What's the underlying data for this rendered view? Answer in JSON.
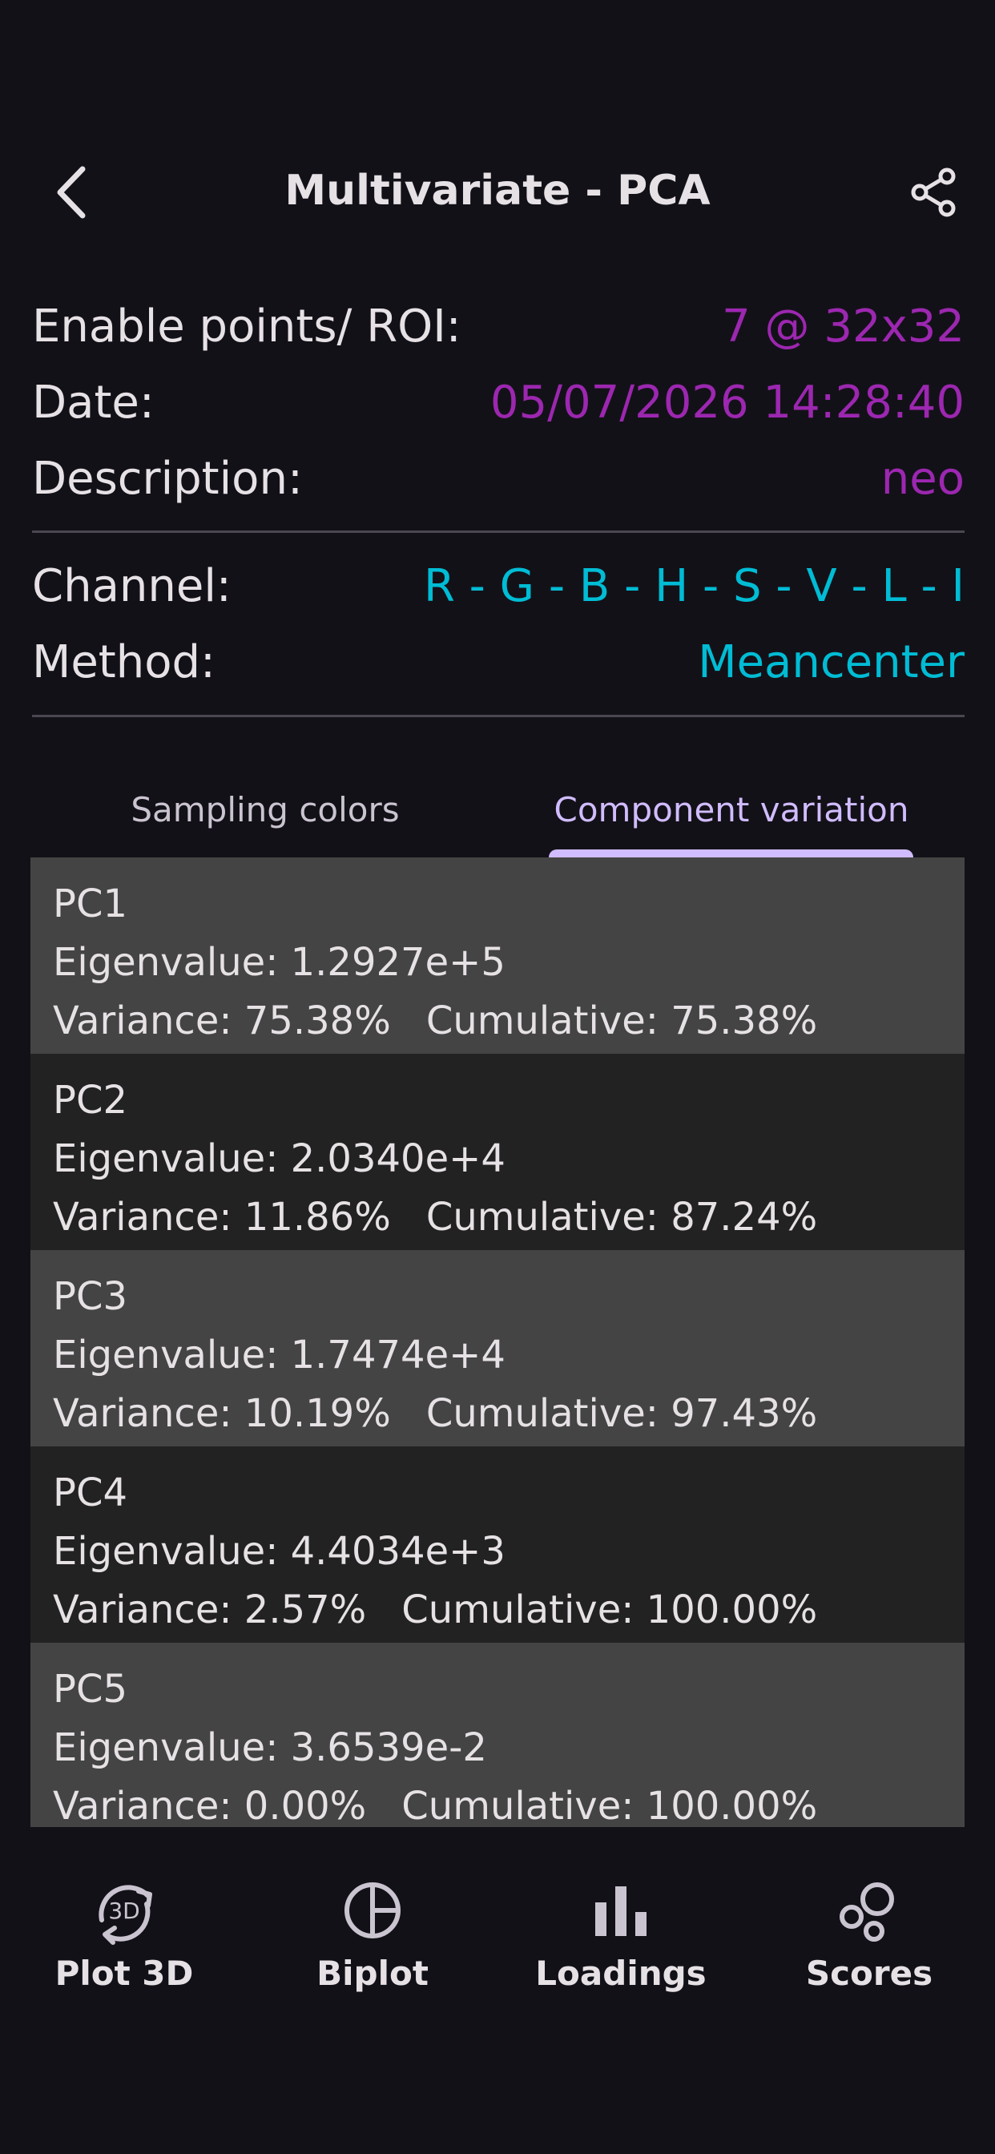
{
  "header": {
    "title": "Multivariate - PCA",
    "back_icon": "chevron-left-icon",
    "share_icon": "share-icon"
  },
  "info": {
    "enable_points_label": "Enable points/ ROI:",
    "enable_points_value": "7 @ 32x32",
    "date_label": "Date:",
    "date_value": "05/07/2026 14:28:40",
    "description_label": "Description:",
    "description_value": "neo",
    "channel_label": "Channel:",
    "channel_value": "R - G - B - H - S - V - L - I",
    "method_label": "Method:",
    "method_value": "Meancenter"
  },
  "tabs": [
    {
      "label": "Sampling colors",
      "active": false
    },
    {
      "label": "Component variation",
      "active": true
    }
  ],
  "components": [
    {
      "name": "PC1",
      "eigenvalue": "Eigenvalue: 1.2927e+5",
      "variance": "Variance: 75.38%",
      "cumulative": "Cumulative: 75.38%"
    },
    {
      "name": "PC2",
      "eigenvalue": "Eigenvalue: 2.0340e+4",
      "variance": "Variance: 11.86%",
      "cumulative": "Cumulative: 87.24%"
    },
    {
      "name": "PC3",
      "eigenvalue": "Eigenvalue: 1.7474e+4",
      "variance": "Variance: 10.19%",
      "cumulative": "Cumulative: 97.43%"
    },
    {
      "name": "PC4",
      "eigenvalue": "Eigenvalue: 4.4034e+3",
      "variance": "Variance: 2.57%",
      "cumulative": "Cumulative: 100.00%"
    },
    {
      "name": "PC5",
      "eigenvalue": "Eigenvalue: 3.6539e-2",
      "variance": "Variance: 0.00%",
      "cumulative": "Cumulative: 100.00%"
    }
  ],
  "bottom_nav": [
    {
      "label": "Plot 3D",
      "icon": "3d-rotate-icon",
      "icon_text": "3D"
    },
    {
      "label": "Biplot",
      "icon": "biplot-icon"
    },
    {
      "label": "Loadings",
      "icon": "bar-chart-icon"
    },
    {
      "label": "Scores",
      "icon": "scatter-bubbles-icon"
    }
  ],
  "colors": {
    "background": "#131118",
    "accent_purple": "#9c27b0",
    "accent_cyan": "#00bcd4",
    "tab_active": "#d0bcff",
    "row_light": "#444444",
    "row_dark": "#222222"
  }
}
